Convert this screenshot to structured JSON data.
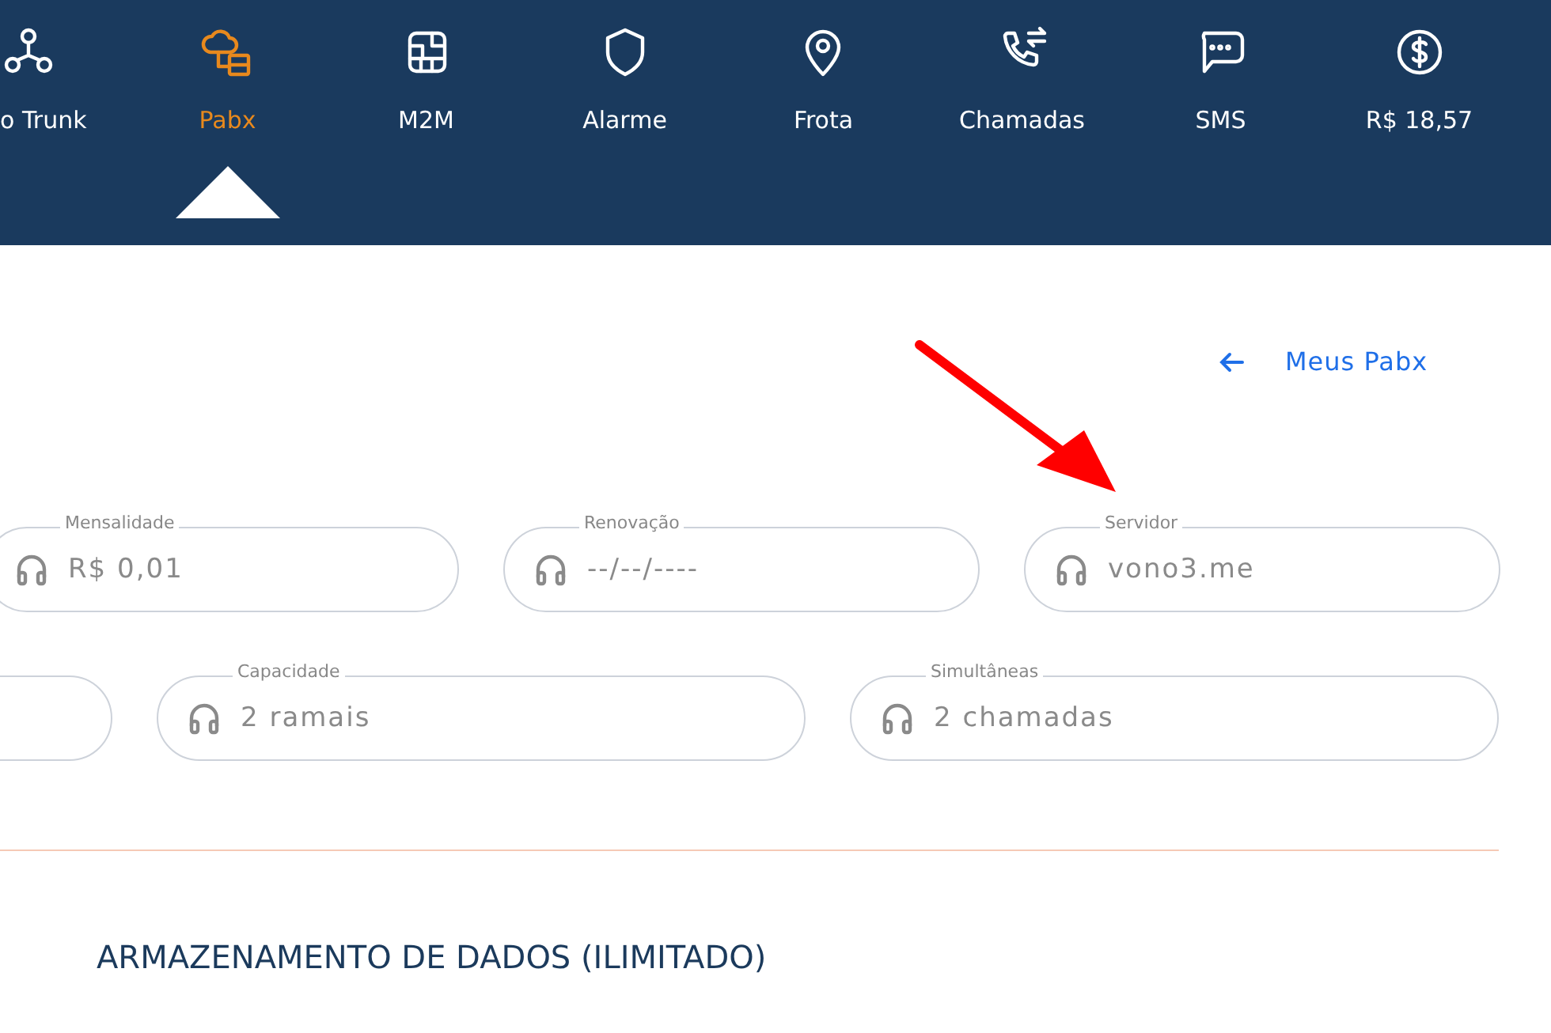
{
  "nav": [
    {
      "label": "o Trunk",
      "selected": false
    },
    {
      "label": "Pabx",
      "selected": true
    },
    {
      "label": "M2M",
      "selected": false
    },
    {
      "label": "Alarme",
      "selected": false
    },
    {
      "label": "Frota",
      "selected": false
    },
    {
      "label": "Chamadas",
      "selected": false
    },
    {
      "label": "SMS",
      "selected": false
    },
    {
      "label": "R$ 18,57",
      "selected": false
    }
  ],
  "back_link": {
    "label": "Meus Pabx"
  },
  "fields_row_1": [
    {
      "label": "Mensalidade",
      "value": "R$ 0,01"
    },
    {
      "label": "Renovação",
      "value": "--/--/----"
    },
    {
      "label": "Servidor",
      "value": "vono3.me"
    }
  ],
  "fields_row_2": [
    {
      "kind": "empty"
    },
    {
      "kind": "filled",
      "label": "Capacidade",
      "value": "2 ramais"
    },
    {
      "kind": "filled",
      "label": "Simultâneas",
      "value": "2 chamadas"
    }
  ],
  "section_title": "ARMAZENAMENTO DE DADOS (ILIMITADO)"
}
